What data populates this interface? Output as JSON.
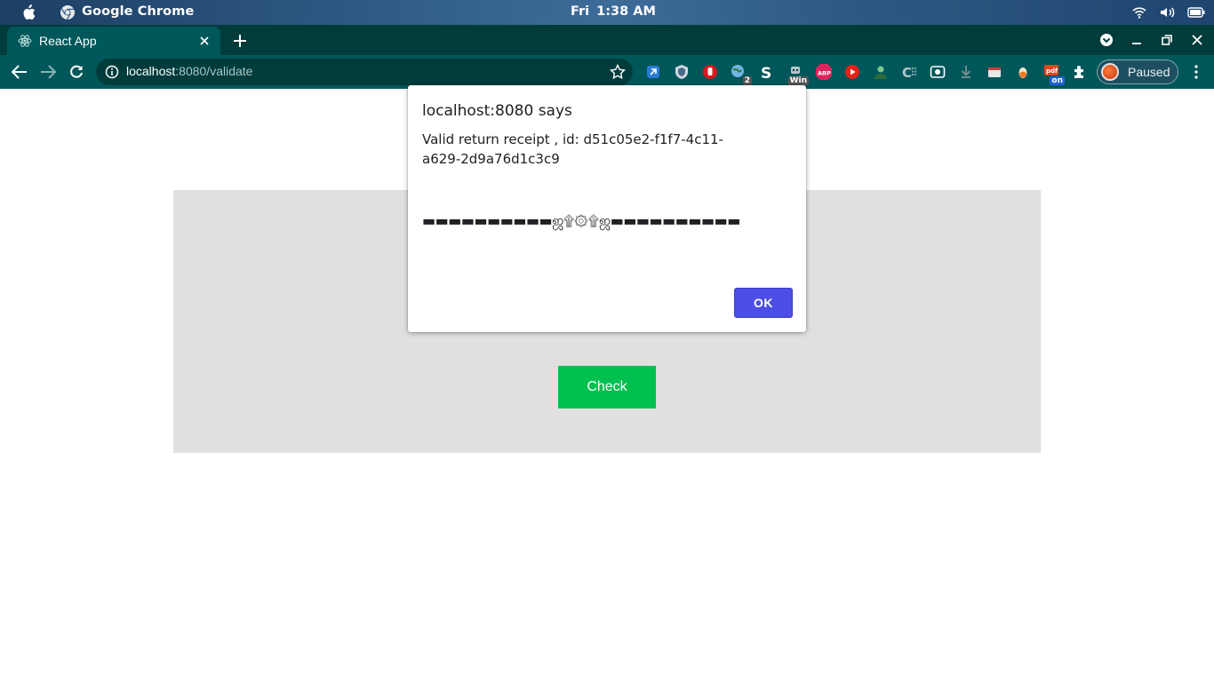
{
  "os": {
    "app_name": "Google Chrome",
    "day": "Fri",
    "time": "1:38 AM"
  },
  "browser": {
    "tab_title": "React App",
    "url_host": "localhost",
    "url_path": ":8080/validate",
    "extensions": [
      {
        "icon": "link-extension-icon",
        "badge": ""
      },
      {
        "icon": "shield-extension-icon",
        "badge": ""
      },
      {
        "icon": "stop-hand-extension-icon",
        "badge": ""
      },
      {
        "icon": "globe-extension-icon",
        "badge": "2"
      },
      {
        "icon": "s-extension-icon",
        "badge": ""
      },
      {
        "icon": "robot-extension-icon",
        "badge": "Win"
      },
      {
        "icon": "abp-extension-icon",
        "badge": "ABP"
      },
      {
        "icon": "youtube-extension-icon",
        "badge": ""
      },
      {
        "icon": "person-extension-icon",
        "badge": ""
      },
      {
        "icon": "code-extension-icon",
        "badge": ""
      },
      {
        "icon": "screen-extension-icon",
        "badge": ""
      },
      {
        "icon": "download-extension-icon",
        "badge": ""
      },
      {
        "icon": "window-extension-icon",
        "badge": ""
      },
      {
        "icon": "drop-extension-icon",
        "badge": ""
      },
      {
        "icon": "pdf-extension-icon",
        "badge": "on"
      },
      {
        "icon": "puzzle-extensions-icon",
        "badge": ""
      }
    ],
    "profile_label": "Paused"
  },
  "page": {
    "check_button_label": "Check"
  },
  "dialog": {
    "title": "localhost:8080 says",
    "message": "Valid return receipt , id: d51c05e2-f1f7-4c11-a629-2d9a76d1c3c9",
    "decoration": "▬▬▬▬▬▬▬▬▬▬ஜ۩۞۩ஜ▬▬▬▬▬▬▬▬▬▬",
    "ok_label": "OK"
  },
  "colors": {
    "chrome_frame": "#003c3c",
    "chrome_toolbar": "#00575a",
    "check_button": "#00c050",
    "ok_button": "#4b4fe6",
    "panel": "#e0e0e0"
  }
}
